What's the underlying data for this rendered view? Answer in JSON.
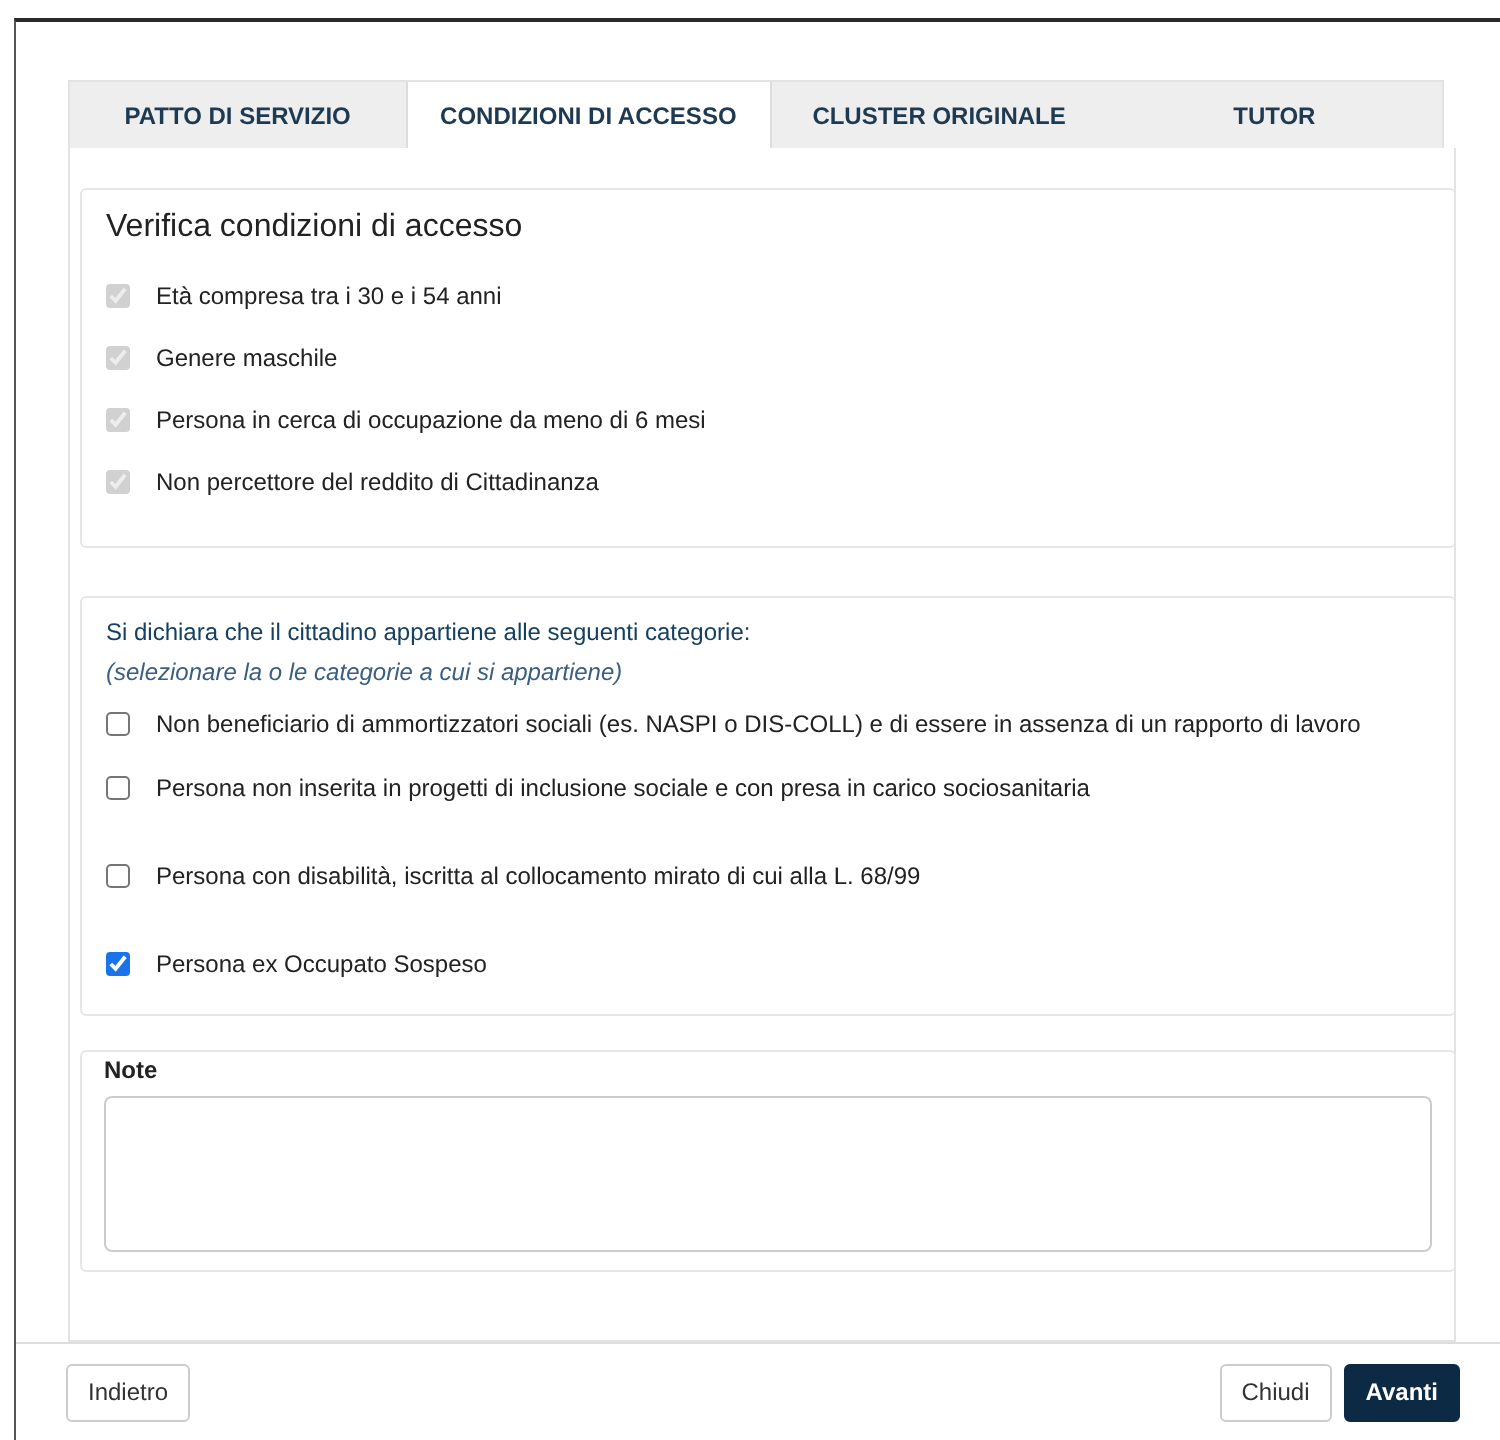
{
  "tabs": [
    {
      "label": "PATTO DI SERVIZIO",
      "selected": false
    },
    {
      "label": "CONDIZIONI DI ACCESSO",
      "selected": true
    },
    {
      "label": "CLUSTER ORIGINALE",
      "selected": false
    },
    {
      "label": "TUTOR",
      "selected": false
    }
  ],
  "verification": {
    "title": "Verifica condizioni di accesso",
    "items": [
      {
        "label": "Età compresa tra i 30 e i 54 anni",
        "checked": true,
        "disabled": true
      },
      {
        "label": "Genere maschile",
        "checked": true,
        "disabled": true
      },
      {
        "label": "Persona in cerca di occupazione da meno di 6 mesi",
        "checked": true,
        "disabled": true
      },
      {
        "label": "Non percettore del reddito di Cittadinanza",
        "checked": true,
        "disabled": true
      }
    ]
  },
  "categories": {
    "title": "Si dichiara che il cittadino appartiene alle seguenti categorie:",
    "hint": "(selezionare la o le categorie a cui si appartiene)",
    "items": [
      {
        "label": "Non beneficiario di ammortizzatori sociali (es. NASPI o DIS-COLL) e di essere in assenza di un rapporto di lavoro",
        "checked": false,
        "disabled": false
      },
      {
        "label": "Persona non inserita in progetti di inclusione sociale e con presa in carico sociosanitaria",
        "checked": false,
        "disabled": false
      },
      {
        "label": "Persona con disabilità, iscritta al collocamento mirato di cui alla L. 68/99",
        "checked": false,
        "disabled": false
      },
      {
        "label": "Persona ex Occupato Sospeso",
        "checked": true,
        "disabled": false
      }
    ]
  },
  "note": {
    "label": "Note"
  },
  "footer": {
    "back": "Indietro",
    "close": "Chiudi",
    "next": "Avanti"
  }
}
